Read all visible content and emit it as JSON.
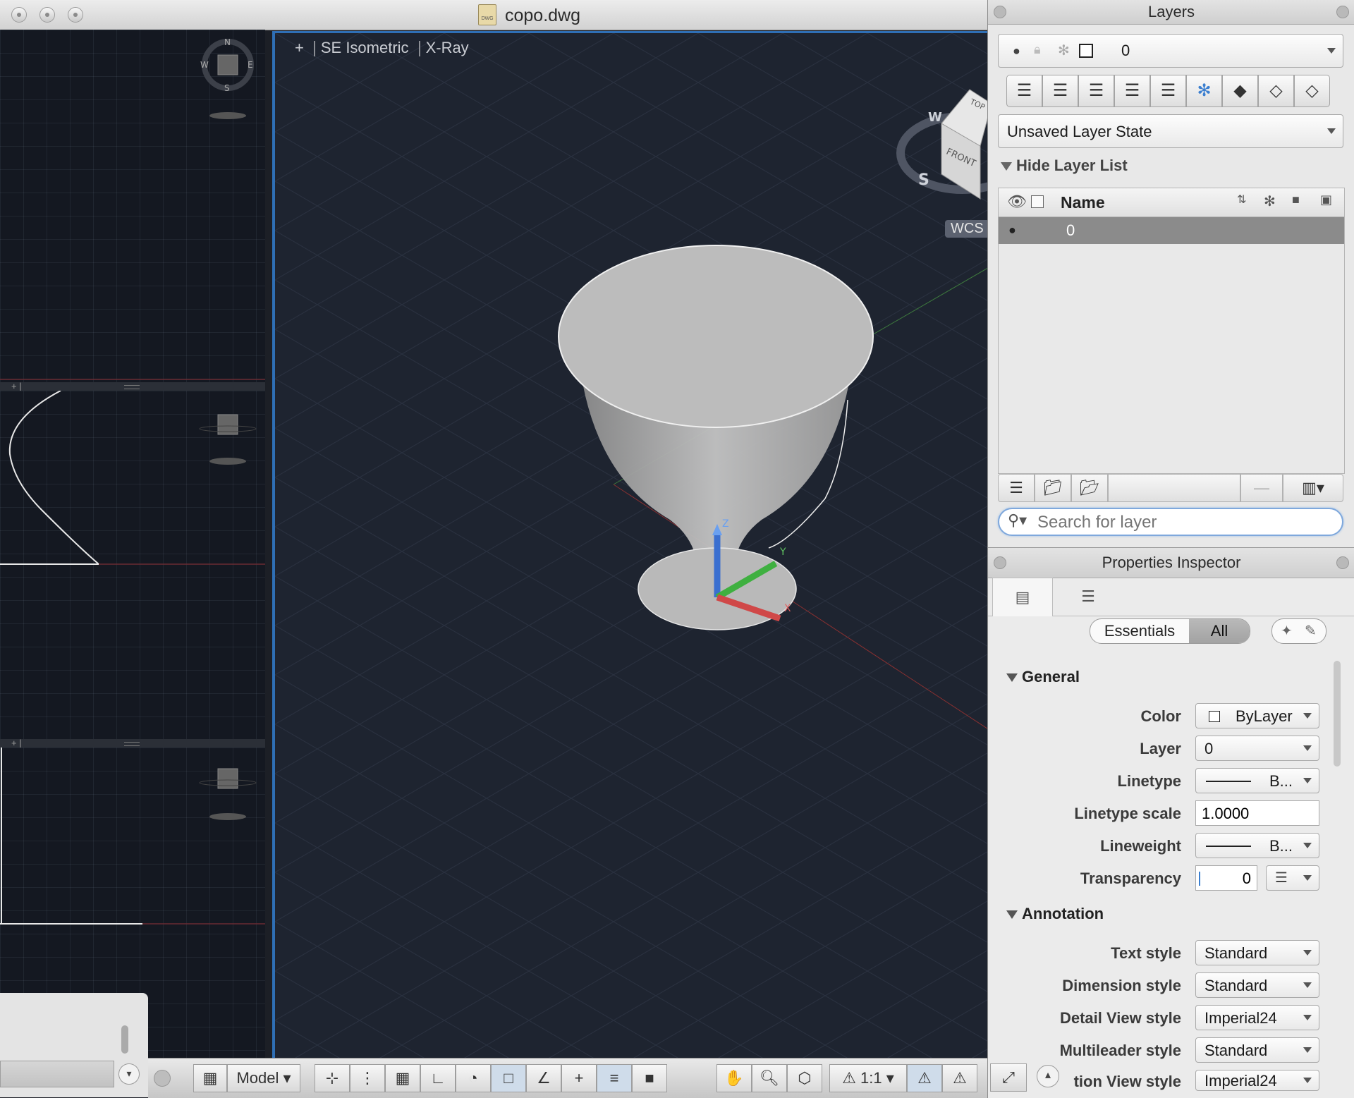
{
  "window": {
    "title": "copo.dwg",
    "file_icon_text": "DWG"
  },
  "viewport": {
    "plus": "+",
    "view_name": "SE Isometric",
    "visual_style": "X-Ray",
    "wcs_label": "WCS",
    "viewcube": {
      "face_front": "FRONT",
      "face_top": "TOP",
      "compass_w": "W",
      "compass_s": "S"
    },
    "ucs_labels": {
      "x": "X",
      "y": "Y",
      "z": "Z"
    }
  },
  "mini_compass": {
    "n": "N",
    "s": "S",
    "e": "E",
    "w": "W"
  },
  "layers_panel": {
    "title": "Layers",
    "current_layer": "0",
    "layer_state": "Unsaved Layer State",
    "hide_list_label": "Hide Layer List",
    "column_name": "Name",
    "rows": [
      {
        "name": "0"
      }
    ],
    "search_placeholder": "Search for layer",
    "toolbar_icons": [
      "new-layer-icon",
      "layer-match-icon",
      "layer-previous-icon",
      "layer-isolate-icon",
      "layer-unisolate-icon",
      "layer-freeze-icon",
      "layer-off-icon",
      "layer-lock-icon",
      "layer-unlock-icon"
    ]
  },
  "properties_panel": {
    "title": "Properties Inspector",
    "mode_essentials": "Essentials",
    "mode_all": "All",
    "general": {
      "heading": "General",
      "color_label": "Color",
      "color_value": "ByLayer",
      "layer_label": "Layer",
      "layer_value": "0",
      "linetype_label": "Linetype",
      "linetype_value": "B...",
      "linetype_scale_label": "Linetype scale",
      "linetype_scale_value": "1.0000",
      "lineweight_label": "Lineweight",
      "lineweight_value": "B...",
      "transparency_label": "Transparency",
      "transparency_value": "0"
    },
    "annotation": {
      "heading": "Annotation",
      "text_style_label": "Text style",
      "text_style_value": "Standard",
      "dimension_style_label": "Dimension style",
      "dimension_style_value": "Standard",
      "detail_view_style_label": "Detail View style",
      "detail_view_style_value": "Imperial24",
      "multileader_style_label": "Multileader style",
      "multileader_style_value": "Standard",
      "section_view_style_label": "tion View style",
      "section_view_style_value": "Imperial24"
    }
  },
  "status_bar": {
    "model_label": "Model",
    "scale_label": "1:1"
  },
  "colors": {
    "accent_blue": "#2f6fb5",
    "viewport_bg": "#1e2430",
    "panel_bg": "#e8e8e8"
  }
}
